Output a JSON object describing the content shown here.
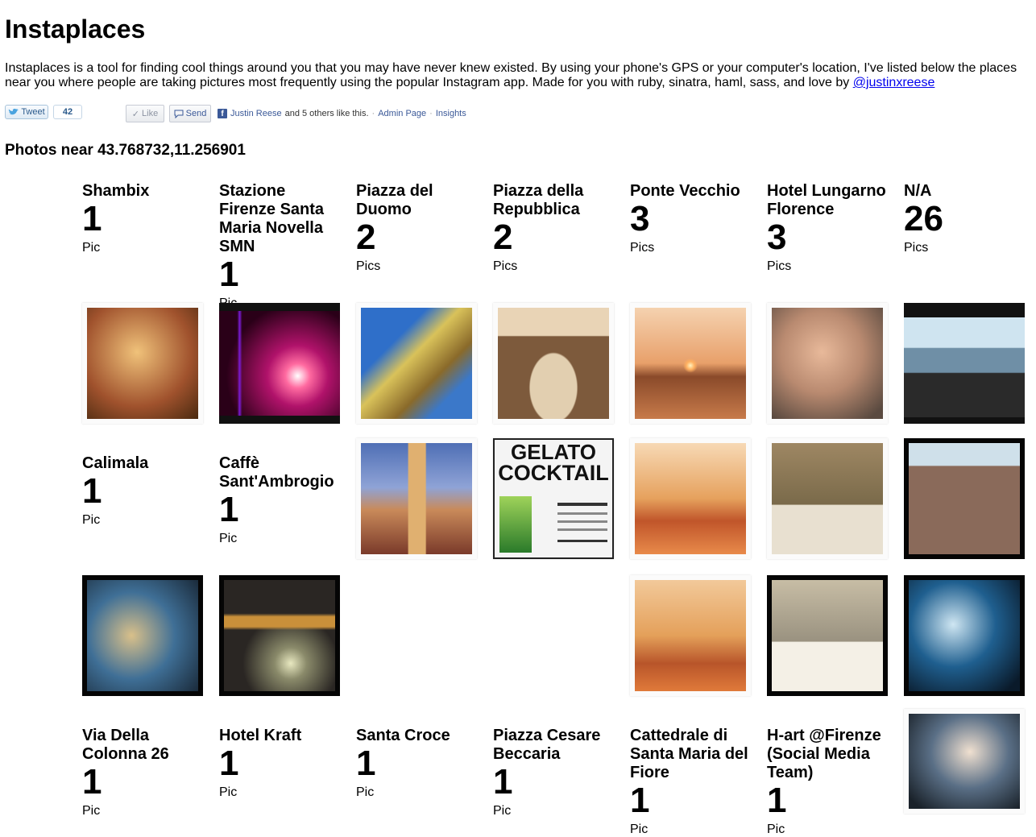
{
  "header": {
    "title": "Instaplaces",
    "intro_text": "Instaplaces is a tool for finding cool things around you that you may have never knew existed. By using your phone's GPS or your computer's location, I've listed below the places near you where people are taking pictures most frequently using the popular Instagram app. Made for you with ruby, sinatra, haml, sass, and love by ",
    "author_link": "@justinxreese"
  },
  "social": {
    "tweet_label": "Tweet",
    "tweet_count": "42",
    "like_label": "Like",
    "send_label": "Send",
    "fb_friend": "Justin Reese",
    "fb_others": "and 5 others like this.",
    "admin_page": "Admin Page",
    "insights": "Insights",
    "sep": "·"
  },
  "photos_heading": "Photos near 43.768732,11.256901",
  "places": [
    {
      "name": "Shambix",
      "count": "1",
      "unit": "Pic"
    },
    {
      "name": "Stazione Firenze Santa Maria Novella SMN",
      "count": "1",
      "unit": "Pic"
    },
    {
      "name": "Piazza del Duomo",
      "count": "2",
      "unit": "Pics"
    },
    {
      "name": "Piazza della Repubblica",
      "count": "2",
      "unit": "Pics"
    },
    {
      "name": "Ponte Vecchio",
      "count": "3",
      "unit": "Pics"
    },
    {
      "name": "Hotel Lungarno Florence",
      "count": "3",
      "unit": "Pics"
    },
    {
      "name": "N/A",
      "count": "26",
      "unit": "Pics"
    },
    {
      "name": "Calimala",
      "count": "1",
      "unit": "Pic"
    },
    {
      "name": "Caffè Sant'Ambrogio",
      "count": "1",
      "unit": "Pic"
    },
    {
      "name": "Via Della Colonna 26",
      "count": "1",
      "unit": "Pic"
    },
    {
      "name": "Hotel Kraft",
      "count": "1",
      "unit": "Pic"
    },
    {
      "name": "Santa Croce",
      "count": "1",
      "unit": "Pic"
    },
    {
      "name": "Piazza Cesare Beccaria",
      "count": "1",
      "unit": "Pic"
    },
    {
      "name": "Cattedrale di Santa Maria del Fiore",
      "count": "1",
      "unit": "Pic"
    },
    {
      "name": "H-art @Firenze (Social Media Team)",
      "count": "1",
      "unit": "Pic"
    }
  ],
  "gelato_poster": {
    "line1": "GELATO",
    "line2": "COCKTAIL"
  },
  "photo_tones": {
    "warm_girl": "#c99a52",
    "red_light": "#b0126a",
    "duomo_sky": "#3b78c9",
    "arch": "#7d5a3c",
    "sunset": "#e8a06a",
    "toddler": "#b98a70",
    "coast": "#6f8fa6",
    "campanile": "#4f6fb5",
    "bridge_warm": "#e6a15d",
    "bath": "#9e8763",
    "cathedral": "#8a6a5a",
    "chalk": "#3f6f96",
    "drink": "#2a2623",
    "bath2": "#c7bda5",
    "blur_blue": "#1f5f8f",
    "metro": "#5a6f86"
  }
}
